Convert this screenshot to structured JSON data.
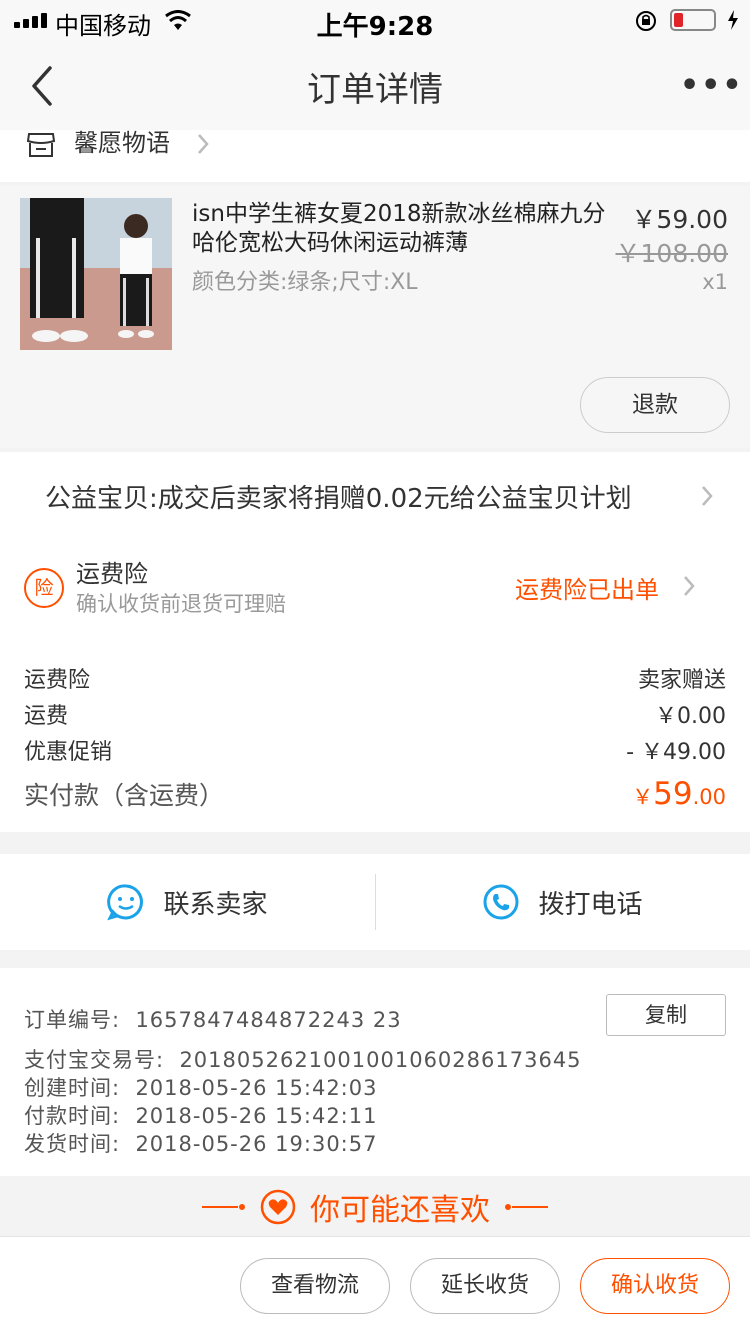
{
  "status_bar": {
    "carrier": "中国移动",
    "time": "上午9:28"
  },
  "nav": {
    "title": "订单详情",
    "more": "•••"
  },
  "shop": {
    "name": "馨愿物语"
  },
  "item": {
    "title": "isn中学生裤女夏2018新款冰丝棉麻九分哈伦宽松大码休闲运动裤薄",
    "sku": "颜色分类:绿条;尺寸:XL",
    "price": "￥59.00",
    "original_price": "￥108.00",
    "quantity": "x1",
    "refund_label": "退款"
  },
  "charity": {
    "text": "公益宝贝:成交后卖家将捐赠0.02元给公益宝贝计划"
  },
  "insurance": {
    "icon_char": "险",
    "title": "运费险",
    "subtitle": "确认收货前退货可理赔",
    "status": "运费险已出单"
  },
  "fees": [
    {
      "label": "运费险",
      "value": "卖家赠送"
    },
    {
      "label": "运费",
      "value": "￥0.00"
    },
    {
      "label": "优惠促销",
      "value": "- ￥49.00"
    }
  ],
  "total": {
    "label": "实付款（含运费）",
    "currency": "￥",
    "integer": "59",
    "decimal": ".00"
  },
  "contact": {
    "seller_label": "联系卖家",
    "phone_label": "拨打电话"
  },
  "order_info": {
    "order_no_label": "订单编号:",
    "order_no": "1657847484872243 23",
    "alipay_label": "支付宝交易号:",
    "alipay_no": "2018052621001001060286173645",
    "created_label": "创建时间:",
    "created": "2018-05-26 15:42:03",
    "paid_label": "付款时间:",
    "paid": "2018-05-26 15:42:11",
    "shipped_label": "发货时间:",
    "shipped": "2018-05-26 19:30:57",
    "copy_label": "复制"
  },
  "recommend": {
    "text": "你可能还喜欢"
  },
  "bottom_actions": {
    "logistics": "查看物流",
    "extend": "延长收货",
    "confirm": "确认收货"
  },
  "colors": {
    "accent": "#ff5000",
    "contact_icon": "#1aa3e8"
  }
}
